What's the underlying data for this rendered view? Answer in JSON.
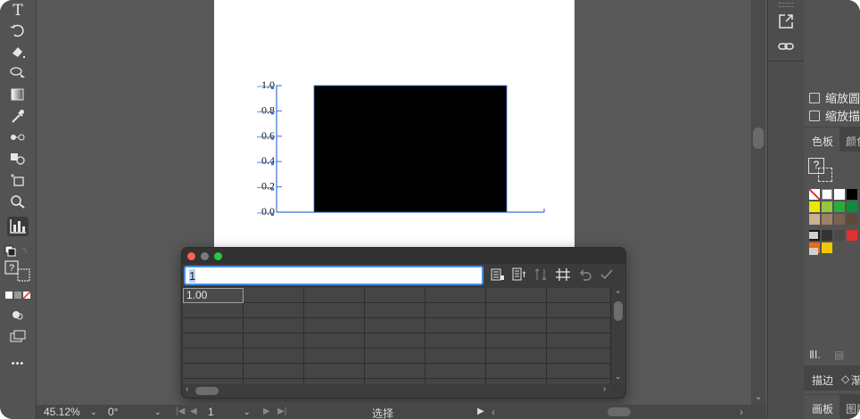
{
  "left_toolbar": {
    "tools": [
      "type-icon",
      "rotate-icon",
      "eraser-icon",
      "lasso-icon",
      "gradient-icon",
      "eyedropper-icon",
      "blend-icon",
      "shape-builder-icon",
      "artboard-icon",
      "zoom-icon",
      "column-graph-icon"
    ],
    "help_mark": "?",
    "more_label": "•••"
  },
  "chart_data": {
    "type": "bar",
    "categories": [
      ""
    ],
    "values": [
      1.0
    ],
    "ylim": [
      0,
      1.0
    ],
    "y_ticks": [
      "1.0",
      "0.8",
      "0.6",
      "0.4",
      "0.2",
      "0.0"
    ],
    "bar_color": "#000000",
    "axis_color": "#3d6fd6"
  },
  "graph_data_dialog": {
    "input_value": "1",
    "toolbar_icons": [
      "import-data-icon",
      "transpose-icon",
      "switch-xy-icon",
      "cell-style-icon",
      "revert-icon",
      "apply-icon"
    ],
    "cells": [
      [
        "1.00",
        "",
        "",
        "",
        "",
        "",
        ""
      ],
      [
        "",
        "",
        "",
        "",
        "",
        "",
        ""
      ],
      [
        "",
        "",
        "",
        "",
        "",
        "",
        ""
      ],
      [
        "",
        "",
        "",
        "",
        "",
        "",
        ""
      ],
      [
        "",
        "",
        "",
        "",
        "",
        "",
        ""
      ],
      [
        "",
        "",
        "",
        "",
        "",
        "",
        ""
      ],
      [
        "",
        "",
        "",
        "",
        "",
        "",
        ""
      ]
    ]
  },
  "status_bar": {
    "zoom": "45.12%",
    "rotation": "0°",
    "artboard_number": "1",
    "tool_name": "选择"
  },
  "right_panel": {
    "checkbox_1": "缩放圆",
    "checkbox_2": "缩放描",
    "tab_swatches": "色板",
    "tab_color": "颜色",
    "help_mark": "?",
    "tab_stroke": "描边",
    "tab_transparency": "渐",
    "tab_artboards": "画板",
    "tab_layers": "图层",
    "swatch_colors": [
      "#ffffff",
      "#000000",
      "#e8e800",
      "#9bc53d",
      "#2eaa3a",
      "#118b3d",
      "#c9b48f",
      "#9c8265",
      "#7a6250",
      "#5e4a3a",
      "#1a1a1a",
      "#333333",
      "#4a4a4a",
      "#e23030",
      "#ee6a10",
      "#f2c800"
    ]
  }
}
